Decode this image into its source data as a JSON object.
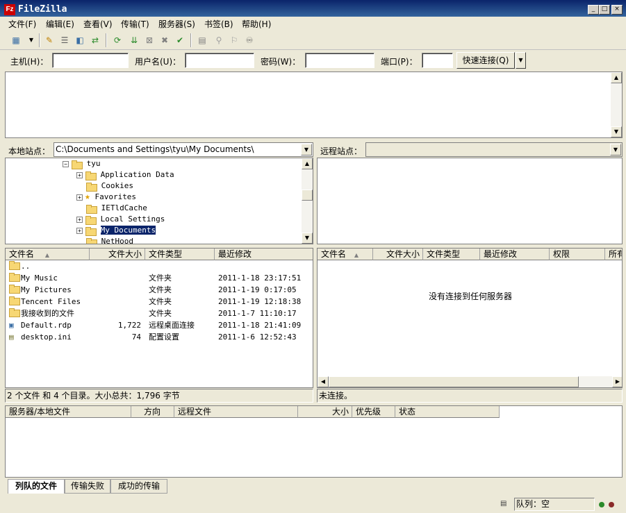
{
  "window": {
    "title": "FileZilla",
    "icon_name": "filezilla-icon",
    "min": "_",
    "max": "□",
    "close": "×"
  },
  "menu": [
    "文件(F)",
    "编辑(E)",
    "查看(V)",
    "传输(T)",
    "服务器(S)",
    "书签(B)",
    "帮助(H)"
  ],
  "toolbar": {
    "icons": [
      "site-manager-icon",
      "toggle-log-icon",
      "toggle-local-tree-icon",
      "toggle-remote-tree-icon",
      "toggle-queue-icon",
      "refresh-icon",
      "process-queue-icon",
      "cancel-icon",
      "disconnect-icon",
      "reconnect-icon",
      "filter-icon",
      "compare-icon",
      "sync-browse-icon",
      "search-icon"
    ]
  },
  "quickconnect": {
    "host_label": "主机(H)：",
    "user_label": "用户名(U)：",
    "pass_label": "密码(W)：",
    "port_label": "端口(P)：",
    "button": "快速连接(Q)",
    "dropdown": "▼"
  },
  "local": {
    "site_label": "本地站点：",
    "path": "C:\\Documents and Settings\\tyu\\My Documents\\",
    "tree": [
      {
        "label": "tyu",
        "expander": "⊟",
        "depth": 0
      },
      {
        "label": "Application Data",
        "expander": "+",
        "depth": 1
      },
      {
        "label": "Cookies",
        "expander": "",
        "depth": 1
      },
      {
        "label": "Favorites",
        "expander": "+",
        "depth": 1,
        "star": true
      },
      {
        "label": "IETldCache",
        "expander": "",
        "depth": 1
      },
      {
        "label": "Local Settings",
        "expander": "+",
        "depth": 1
      },
      {
        "label": "My Documents",
        "expander": "+",
        "depth": 1,
        "selected": true
      },
      {
        "label": "NetHood",
        "expander": "",
        "depth": 1
      }
    ],
    "columns": [
      "文件名",
      "文件大小",
      "文件类型",
      "最近修改"
    ],
    "files": [
      {
        "name": "..",
        "size": "",
        "type": "",
        "modified": "",
        "icon": "parent-folder-icon"
      },
      {
        "name": "My Music",
        "size": "",
        "type": "文件夹",
        "modified": "2011-1-18 23:17:51",
        "icon": "music-folder-icon"
      },
      {
        "name": "My Pictures",
        "size": "",
        "type": "文件夹",
        "modified": "2011-1-19 0:17:05",
        "icon": "pictures-folder-icon"
      },
      {
        "name": "Tencent Files",
        "size": "",
        "type": "文件夹",
        "modified": "2011-1-19 12:18:38",
        "icon": "folder-icon"
      },
      {
        "name": "我接收到的文件",
        "size": "",
        "type": "文件夹",
        "modified": "2011-1-7 11:10:17",
        "icon": "folder-icon"
      },
      {
        "name": "Default.rdp",
        "size": "1,722",
        "type": "远程桌面连接",
        "modified": "2011-1-18 21:41:09",
        "icon": "rdp-file-icon"
      },
      {
        "name": "desktop.ini",
        "size": "74",
        "type": "配置设置",
        "modified": "2011-1-6 12:52:43",
        "icon": "ini-file-icon"
      }
    ],
    "status": "2 个文件 和 4 个目录。大小总共：1,796 字节"
  },
  "remote": {
    "site_label": "远程站点：",
    "columns": [
      "文件名",
      "文件大小",
      "文件类型",
      "最近修改",
      "权限",
      "所有"
    ],
    "empty_message": "没有连接到任何服务器",
    "status": "未连接。"
  },
  "queue": {
    "columns": [
      "服务器/本地文件",
      "方向",
      "远程文件",
      "大小",
      "优先级",
      "状态"
    ],
    "tabs": [
      "列队的文件",
      "传输失败",
      "成功的传输"
    ],
    "active_tab": 0
  },
  "statusbar": {
    "queue_label": "队列：空"
  },
  "colors": {
    "titlebar_start": "#0a246a",
    "titlebar_end": "#3a6ea5",
    "selection": "#0a246a",
    "led_green": "#2a8a2a",
    "led_red": "#8a2a2a"
  }
}
